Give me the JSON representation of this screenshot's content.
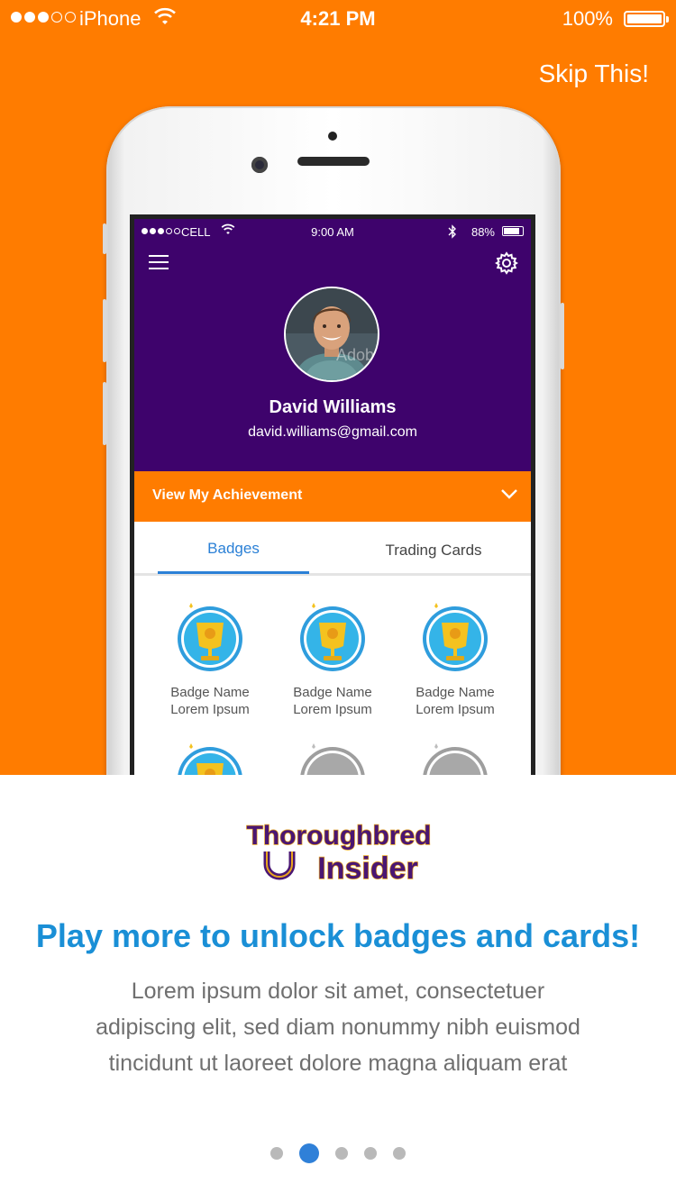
{
  "status_bar": {
    "carrier": "iPhone",
    "time": "4:21 PM",
    "battery": "100%",
    "signal_filled": 3,
    "signal_total": 5,
    "battery_level": 1.0
  },
  "skip_label": "Skip This!",
  "mock_app": {
    "status_bar": {
      "carrier": "CELL",
      "time": "9:00 AM",
      "battery": "88%",
      "battery_level": 0.88
    },
    "profile": {
      "name": "David Williams",
      "email": "david.williams@gmail.com",
      "avatar_overlay_text": "Adobe"
    },
    "achievement_label": "View My Achievement",
    "tabs": [
      {
        "label": "Badges",
        "active": true
      },
      {
        "label": "Trading Cards",
        "active": false
      }
    ],
    "badges": [
      {
        "line1": "Badge Name",
        "line2": "Lorem Ipsum",
        "unlocked": true
      },
      {
        "line1": "Badge Name",
        "line2": "Lorem Ipsum",
        "unlocked": true
      },
      {
        "line1": "Badge Name",
        "line2": "Lorem Ipsum",
        "unlocked": true
      },
      {
        "unlocked": true
      },
      {
        "unlocked": false
      },
      {
        "unlocked": false
      }
    ]
  },
  "logo": {
    "line1": "Thoroughbred",
    "line2": "Insider"
  },
  "headline": "Play more to unlock badges and cards!",
  "body_lines": [
    "Lorem ipsum dolor sit amet, consectetuer",
    "adipiscing elit, sed diam nonummy nibh euismod",
    "tincidunt ut laoreet dolore magna aliquam erat"
  ],
  "pager": {
    "total": 5,
    "active_index": 1
  },
  "colors": {
    "orange": "#FF7C00",
    "purple": "#3E036C",
    "headline_blue": "#1A8FD6",
    "tab_blue": "#2B80D6",
    "pager_active": "#2F80D8",
    "logo_gold": "#E8A51E"
  },
  "icons": [
    "wifi-icon",
    "battery-icon",
    "bluetooth-icon",
    "hamburger-menu-icon",
    "settings-gear-icon",
    "chevron-down-icon",
    "trophy-badge-icon",
    "locked-badge-icon",
    "horseshoe-icon"
  ]
}
